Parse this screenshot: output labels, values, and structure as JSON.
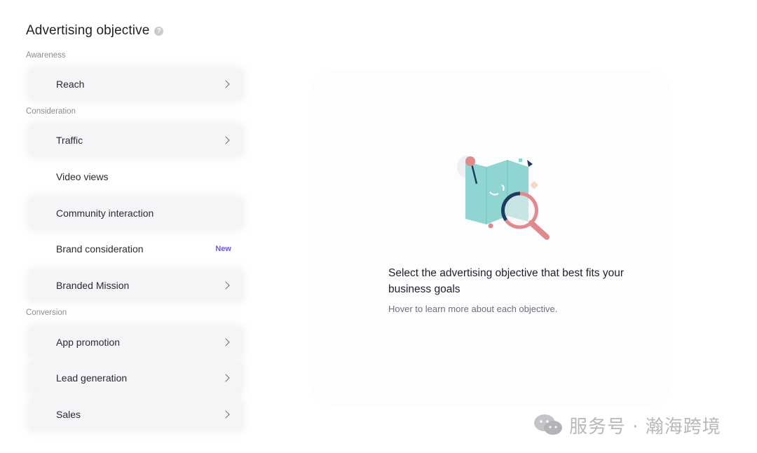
{
  "header": {
    "title": "Advertising objective"
  },
  "sections": {
    "awareness": "Awareness",
    "consideration": "Consideration",
    "conversion": "Conversion"
  },
  "items": {
    "reach": "Reach",
    "traffic": "Traffic",
    "video_views": "Video views",
    "community_interaction": "Community interaction",
    "brand_consideration": "Brand consideration",
    "brand_consideration_badge": "New",
    "branded_mission": "Branded Mission",
    "app_promotion": "App promotion",
    "lead_generation": "Lead generation",
    "sales": "Sales"
  },
  "empty_state": {
    "message": "Select the advertising objective that best fits your business goals",
    "hint": "Hover to learn more about each objective."
  },
  "watermark": {
    "text": "服务号 · 瀚海跨境"
  },
  "colors": {
    "badge": "#6a5ae0",
    "map": "#8fd6d3",
    "pin": "#e08a8f",
    "lens": "#1f3a5f"
  }
}
